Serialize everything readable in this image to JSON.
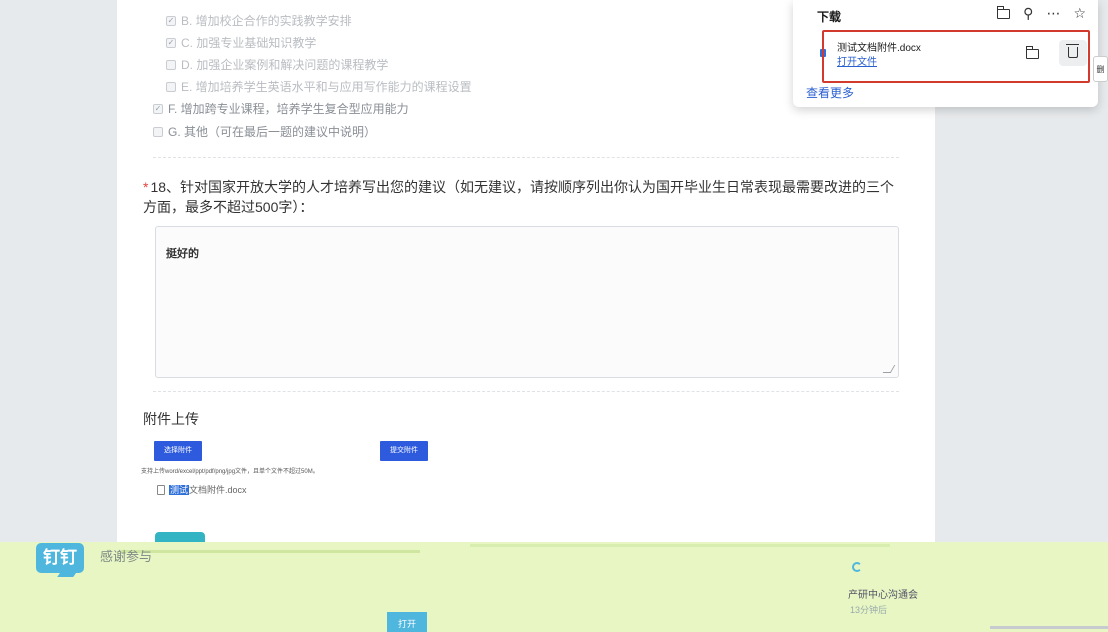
{
  "options": [
    {
      "label": "B. 增加校企合作的实践教学安排",
      "checked": true
    },
    {
      "label": "C. 加强专业基础知识教学",
      "checked": true
    },
    {
      "label": "D. 加强企业案例和解决问题的课程教学",
      "checked": false
    },
    {
      "label": "E. 增加培养学生英语水平和与应用写作能力的课程设置",
      "checked": false
    },
    {
      "label": "F. 增加跨专业课程，培养学生复合型应用能力",
      "checked": true
    },
    {
      "label": "G. 其他（可在最后一题的建议中说明）",
      "checked": false
    }
  ],
  "question": {
    "required_mark": "*",
    "text": "18、针对国家开放大学的人才培养写出您的建议（如无建议，请按顺序列出你认为国开毕业生日常表现最需要改进的三个方面，最多不超过500字）："
  },
  "answer": {
    "value": "挺好的"
  },
  "attachment": {
    "title": "附件上传",
    "select_label": "选择附件",
    "submit_label": "提交附件",
    "hint": "支持上传word/excel/ppt/pdf/png/jpg文件，且单个文件不超过50M。",
    "file_highlight": "测试",
    "file_rest": "文档附件.docx"
  },
  "banner": {
    "logo_text": "钉钉",
    "thanks": "感谢参与",
    "meeting": "产研中心沟通会",
    "when": "13分钟后",
    "open_label": "打开"
  },
  "downloads": {
    "title": "下载",
    "file_name": "测试文档附件.docx",
    "open_file": "打开文件",
    "see_more": "查看更多",
    "side_tip": "删",
    "icons": [
      "folder-icon",
      "search-icon",
      "more-icon",
      "pin-icon",
      "trash-icon"
    ]
  },
  "colors": {
    "accent": "#2e5bde",
    "link": "#2a5fd0",
    "highlight_box": "#d23a2e",
    "banner": "#e8f6c4"
  }
}
